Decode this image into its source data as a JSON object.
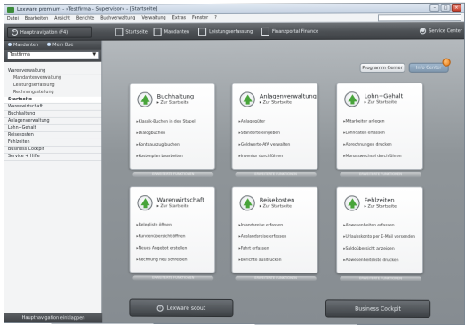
{
  "window": {
    "title": "Lexware premium - »Testfirma - Supervisor« - [Startseite]",
    "controls": [
      "minimize",
      "maximize",
      "close"
    ]
  },
  "menu": [
    "Datei",
    "Bearbeiten",
    "Ansicht",
    "Berichte",
    "Buchverwaltung",
    "Verwaltung",
    "Extras",
    "Fenster",
    "?"
  ],
  "toolbar": {
    "nav_button": "Hauptnavigation (F4)",
    "items": [
      {
        "label": "Startseite",
        "icon": "home-icon"
      },
      {
        "label": "Mandanten",
        "icon": "folder-icon"
      },
      {
        "label": "Leistungserfassung",
        "icon": "document-icon"
      },
      {
        "label": "Finanzportal Finance",
        "icon": "finance-icon"
      }
    ],
    "service": {
      "label": "Service Center",
      "icon": "lightbulb-icon"
    }
  },
  "sidebar": {
    "tabs": [
      "Mandanten",
      "Mein Bue"
    ],
    "company": "Testfirma",
    "items": [
      {
        "label": "Warenverwaltung",
        "type": "top"
      },
      {
        "label": "Mandantenverwaltung",
        "type": "sub"
      },
      {
        "label": "Leistungserfassung",
        "type": "sub"
      },
      {
        "label": "Rechnungsstellung",
        "type": "sub"
      },
      {
        "label": "Startseite",
        "type": "top",
        "selected": true
      },
      {
        "label": "Warenwirtschaft",
        "type": "top"
      },
      {
        "label": "Buchhaltung",
        "type": "top"
      },
      {
        "label": "Anlagenverwaltung",
        "type": "top"
      },
      {
        "label": "Lohn+Gehalt",
        "type": "top"
      },
      {
        "label": "Reisekosten",
        "type": "top"
      },
      {
        "label": "Fehlzeiten",
        "type": "top"
      },
      {
        "label": "Business Cockpit",
        "type": "top"
      },
      {
        "label": "Service + Hilfe",
        "type": "top"
      }
    ],
    "footer": "Hauptnavigation einklappen"
  },
  "content": {
    "tabs": [
      {
        "label": "Programm Center",
        "active": true
      },
      {
        "label": "Info Center",
        "active": false
      }
    ],
    "cards": [
      {
        "title": "Buchhaltung",
        "link": "Zur Startseite",
        "items": [
          "Klassik-Buchen in den Stapel",
          "Dialogbuchen",
          "Kontoauszug buchen",
          "Kostenplan bearbeiten"
        ],
        "footer": "ERWEITERTE FUNKTIONEN"
      },
      {
        "title": "Anlagenverwaltung",
        "link": "Zur Startseite",
        "items": [
          "Anlagegüter",
          "Standorte eingeben",
          "Geldwerte-AfA verwalten",
          "Inventur durchführen"
        ],
        "footer": "ERWEITERTE FUNKTIONEN"
      },
      {
        "title": "Lohn+Gehalt",
        "link": "Zur Startseite",
        "items": [
          "Mitarbeiter anlegen",
          "Lohndaten erfassen",
          "Abrechnungen drucken",
          "Monatswechsel durchführen"
        ],
        "footer": "ERWEITERTE FUNKTIONEN"
      },
      {
        "title": "Warenwirtschaft",
        "link": "Zur Startseite",
        "items": [
          "Belegliste öffnen",
          "Kundenübersicht öffnen",
          "Neues Angebot erstellen",
          "Rechnung neu schreiben"
        ],
        "footer": "ERWEITERTE FUNKTIONEN"
      },
      {
        "title": "Reisekosten",
        "link": "Zur Startseite",
        "items": [
          "Inlandsreise erfassen",
          "Auslandsreise erfassen",
          "Fahrt erfassen",
          "Berichte ausdrucken"
        ],
        "footer": "ERWEITERTE FUNKTIONEN"
      },
      {
        "title": "Fehlzeiten",
        "link": "Zur Startseite",
        "items": [
          "Abwesenheiten erfassen",
          "Urlaubskonto per E-Mail versenden",
          "Saldoübersicht anzeigen",
          "Abwesenheitsliste drucken"
        ],
        "footer": "ERWEITERTE FUNKTIONEN"
      }
    ],
    "bottom_buttons": [
      {
        "label": "Lexware scout",
        "icon": "info-icon"
      },
      {
        "label": "Business Cockpit",
        "icon": ""
      }
    ]
  },
  "colors": {
    "accent": "#48a43a",
    "toolbar": "#4c5054",
    "badge": "#ea7a12"
  }
}
